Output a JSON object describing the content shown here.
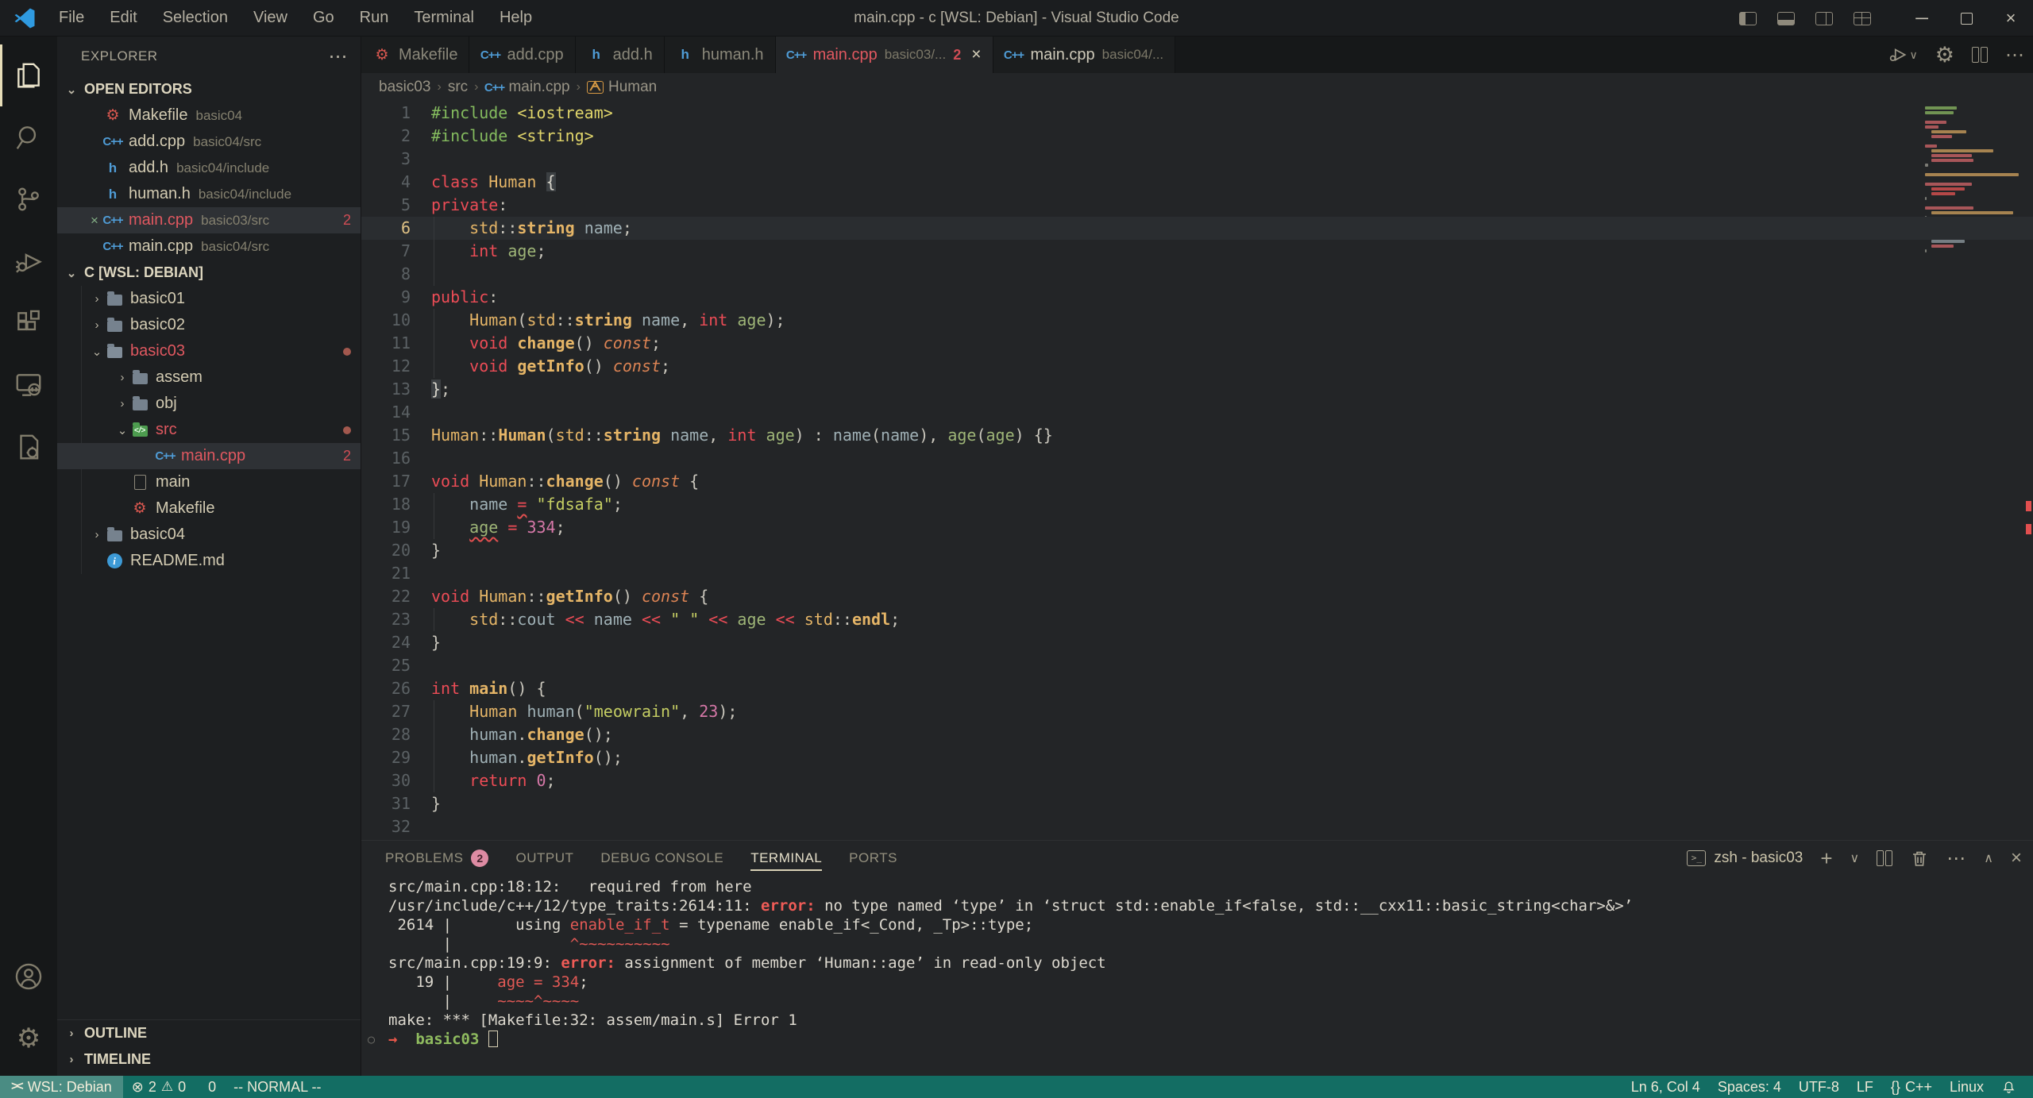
{
  "window": {
    "title": "main.cpp - c [WSL: Debian] - Visual Studio Code",
    "menu": [
      "File",
      "Edit",
      "Selection",
      "View",
      "Go",
      "Run",
      "Terminal",
      "Help"
    ]
  },
  "activity_bar": [
    "explorer",
    "search",
    "source-control",
    "run-and-debug",
    "extensions",
    "remote-explorer",
    "makefile-tools"
  ],
  "sidebar": {
    "title": "EXPLORER",
    "more_label": "⋯",
    "open_editors_label": "OPEN EDITORS",
    "open_editors": [
      {
        "icon": "makefile",
        "name": "Makefile",
        "desc": "basic04"
      },
      {
        "icon": "cpp",
        "name": "add.cpp",
        "desc": "basic04/src"
      },
      {
        "icon": "h",
        "name": "add.h",
        "desc": "basic04/include"
      },
      {
        "icon": "h",
        "name": "human.h",
        "desc": "basic04/include"
      },
      {
        "icon": "cpp",
        "name": "main.cpp",
        "desc": "basic03/src",
        "error": true,
        "badge": "2",
        "selected": true,
        "closable": true
      },
      {
        "icon": "cpp",
        "name": "main.cpp",
        "desc": "basic04/src"
      }
    ],
    "root_label": "C [WSL: DEBIAN]",
    "tree": [
      {
        "level": 1,
        "chev": "›",
        "icon": "folder",
        "name": "basic01"
      },
      {
        "level": 1,
        "chev": "›",
        "icon": "folder",
        "name": "basic02"
      },
      {
        "level": 1,
        "chev": "⌄",
        "icon": "folder-open",
        "name": "basic03",
        "error": true,
        "dot": true
      },
      {
        "level": 2,
        "chev": "›",
        "icon": "folder",
        "name": "assem"
      },
      {
        "level": 2,
        "chev": "›",
        "icon": "folder",
        "name": "obj"
      },
      {
        "level": 2,
        "chev": "⌄",
        "icon": "folder-src",
        "name": "src",
        "error": true,
        "dot": true
      },
      {
        "level": 3,
        "icon": "cpp",
        "name": "main.cpp",
        "error": true,
        "badge": "2",
        "selected": true
      },
      {
        "level": 2,
        "icon": "file",
        "name": "main"
      },
      {
        "level": 2,
        "icon": "makefile",
        "name": "Makefile"
      },
      {
        "level": 1,
        "chev": "›",
        "icon": "folder",
        "name": "basic04"
      },
      {
        "level": 1,
        "icon": "info",
        "name": "README.md"
      }
    ],
    "outline_label": "OUTLINE",
    "timeline_label": "TIMELINE"
  },
  "tabs": [
    {
      "icon": "makefile",
      "name": "Makefile"
    },
    {
      "icon": "cpp",
      "name": "add.cpp"
    },
    {
      "icon": "h",
      "name": "add.h"
    },
    {
      "icon": "h",
      "name": "human.h"
    },
    {
      "icon": "cpp",
      "name": "main.cpp",
      "desc": "basic03/...",
      "badge": "2",
      "active": true,
      "error": true,
      "closable": true
    },
    {
      "icon": "cpp",
      "name": "main.cpp",
      "desc": "basic04/...",
      "lit": true
    }
  ],
  "breadcrumb": [
    {
      "label": "basic03"
    },
    {
      "label": "src"
    },
    {
      "label": "main.cpp",
      "icon": "cpp"
    },
    {
      "label": "Human",
      "icon": "class"
    }
  ],
  "editor": {
    "lines": [
      {
        "n": 1,
        "t": [
          [
            "inc",
            "#include "
          ],
          [
            "ang",
            "<iostream>"
          ]
        ]
      },
      {
        "n": 2,
        "t": [
          [
            "inc",
            "#include "
          ],
          [
            "ang",
            "<string>"
          ]
        ]
      },
      {
        "n": 3,
        "t": []
      },
      {
        "n": 4,
        "t": [
          [
            "kw",
            "class "
          ],
          [
            "cls",
            "Human "
          ],
          [
            "brk",
            "{"
          ]
        ]
      },
      {
        "n": 5,
        "t": [
          [
            "kw",
            "private"
          ],
          [
            "pun",
            ":"
          ]
        ]
      },
      {
        "n": 6,
        "cur": true,
        "g": 1,
        "t": [
          [
            "pun",
            "    "
          ],
          [
            "std",
            "std"
          ],
          [
            "pun",
            "::"
          ],
          [
            "fn",
            "string"
          ],
          [
            "pun",
            " "
          ],
          [
            "id",
            "name"
          ],
          [
            "pun",
            ";"
          ]
        ]
      },
      {
        "n": 7,
        "g": 1,
        "t": [
          [
            "pun",
            "    "
          ],
          [
            "kw",
            "int"
          ],
          [
            "pun",
            " "
          ],
          [
            "grn",
            "age"
          ],
          [
            "pun",
            ";"
          ]
        ]
      },
      {
        "n": 8,
        "g": 1,
        "t": []
      },
      {
        "n": 9,
        "t": [
          [
            "kw",
            "public"
          ],
          [
            "pun",
            ":"
          ]
        ]
      },
      {
        "n": 10,
        "g": 1,
        "t": [
          [
            "pun",
            "    "
          ],
          [
            "cls",
            "Human"
          ],
          [
            "pun",
            "("
          ],
          [
            "std",
            "std"
          ],
          [
            "pun",
            "::"
          ],
          [
            "fn",
            "string"
          ],
          [
            "pun",
            " "
          ],
          [
            "id",
            "name"
          ],
          [
            "pun",
            ", "
          ],
          [
            "kw",
            "int"
          ],
          [
            "pun",
            " "
          ],
          [
            "grn",
            "age"
          ],
          [
            "pun",
            ");"
          ]
        ]
      },
      {
        "n": 11,
        "g": 1,
        "t": [
          [
            "pun",
            "    "
          ],
          [
            "kw",
            "void"
          ],
          [
            "pun",
            " "
          ],
          [
            "fn",
            "change"
          ],
          [
            "pun",
            "() "
          ],
          [
            "const",
            "const"
          ],
          [
            "pun",
            ";"
          ]
        ]
      },
      {
        "n": 12,
        "g": 1,
        "t": [
          [
            "pun",
            "    "
          ],
          [
            "kw",
            "void"
          ],
          [
            "pun",
            " "
          ],
          [
            "fn",
            "getInfo"
          ],
          [
            "pun",
            "() "
          ],
          [
            "const",
            "const"
          ],
          [
            "pun",
            ";"
          ]
        ]
      },
      {
        "n": 13,
        "t": [
          [
            "brk",
            "}"
          ],
          [
            "pun",
            ";"
          ]
        ]
      },
      {
        "n": 14,
        "t": []
      },
      {
        "n": 15,
        "t": [
          [
            "cls",
            "Human"
          ],
          [
            "pun",
            "::"
          ],
          [
            "fn",
            "Human"
          ],
          [
            "pun",
            "("
          ],
          [
            "std",
            "std"
          ],
          [
            "pun",
            "::"
          ],
          [
            "fn",
            "string"
          ],
          [
            "pun",
            " "
          ],
          [
            "id",
            "name"
          ],
          [
            "pun",
            ", "
          ],
          [
            "kw",
            "int"
          ],
          [
            "pun",
            " "
          ],
          [
            "grn",
            "age"
          ],
          [
            "pun",
            ") : "
          ],
          [
            "id",
            "name"
          ],
          [
            "pun",
            "("
          ],
          [
            "id",
            "name"
          ],
          [
            "pun",
            "), "
          ],
          [
            "grn",
            "age"
          ],
          [
            "pun",
            "("
          ],
          [
            "grn",
            "age"
          ],
          [
            "pun",
            ") {}"
          ]
        ]
      },
      {
        "n": 16,
        "t": []
      },
      {
        "n": 17,
        "t": [
          [
            "kw",
            "void"
          ],
          [
            "pun",
            " "
          ],
          [
            "cls",
            "Human"
          ],
          [
            "pun",
            "::"
          ],
          [
            "fn",
            "change"
          ],
          [
            "pun",
            "() "
          ],
          [
            "const",
            "const"
          ],
          [
            "pun",
            " {"
          ]
        ]
      },
      {
        "n": 18,
        "g": 1,
        "t": [
          [
            "pun",
            "    "
          ],
          [
            "id",
            "name"
          ],
          [
            "pun",
            " "
          ],
          [
            "op err",
            "="
          ],
          [
            "pun",
            " "
          ],
          [
            "str",
            "\"fdsafa\""
          ],
          [
            "pun",
            ";"
          ]
        ]
      },
      {
        "n": 19,
        "g": 1,
        "t": [
          [
            "pun",
            "    "
          ],
          [
            "grn err",
            "age"
          ],
          [
            "pun",
            " "
          ],
          [
            "op",
            "="
          ],
          [
            "pun",
            " "
          ],
          [
            "num",
            "334"
          ],
          [
            "pun",
            ";"
          ]
        ]
      },
      {
        "n": 20,
        "t": [
          [
            "pun",
            "}"
          ]
        ]
      },
      {
        "n": 21,
        "t": []
      },
      {
        "n": 22,
        "t": [
          [
            "kw",
            "void"
          ],
          [
            "pun",
            " "
          ],
          [
            "cls",
            "Human"
          ],
          [
            "pun",
            "::"
          ],
          [
            "fn",
            "getInfo"
          ],
          [
            "pun",
            "() "
          ],
          [
            "const",
            "const"
          ],
          [
            "pun",
            " {"
          ]
        ]
      },
      {
        "n": 23,
        "g": 1,
        "t": [
          [
            "pun",
            "    "
          ],
          [
            "std",
            "std"
          ],
          [
            "pun",
            "::"
          ],
          [
            "id",
            "cout"
          ],
          [
            "pun",
            " "
          ],
          [
            "op",
            "<<"
          ],
          [
            "pun",
            " "
          ],
          [
            "id",
            "name"
          ],
          [
            "pun",
            " "
          ],
          [
            "op",
            "<<"
          ],
          [
            "pun",
            " "
          ],
          [
            "str",
            "\" \""
          ],
          [
            "pun",
            " "
          ],
          [
            "op",
            "<<"
          ],
          [
            "pun",
            " "
          ],
          [
            "grn",
            "age"
          ],
          [
            "pun",
            " "
          ],
          [
            "op",
            "<<"
          ],
          [
            "pun",
            " "
          ],
          [
            "std",
            "std"
          ],
          [
            "pun",
            "::"
          ],
          [
            "fn",
            "endl"
          ],
          [
            "pun",
            ";"
          ]
        ]
      },
      {
        "n": 24,
        "t": [
          [
            "pun",
            "}"
          ]
        ]
      },
      {
        "n": 25,
        "t": []
      },
      {
        "n": 26,
        "t": [
          [
            "kw",
            "int"
          ],
          [
            "pun",
            " "
          ],
          [
            "fn",
            "main"
          ],
          [
            "pun",
            "() {"
          ]
        ]
      },
      {
        "n": 27,
        "g": 1,
        "t": [
          [
            "pun",
            "    "
          ],
          [
            "cls",
            "Human"
          ],
          [
            "pun",
            " "
          ],
          [
            "id",
            "human"
          ],
          [
            "pun",
            "("
          ],
          [
            "str",
            "\"meowrain\""
          ],
          [
            "pun",
            ", "
          ],
          [
            "num",
            "23"
          ],
          [
            "pun",
            ");"
          ]
        ]
      },
      {
        "n": 28,
        "g": 1,
        "t": [
          [
            "pun",
            "    "
          ],
          [
            "id",
            "human"
          ],
          [
            "pun",
            "."
          ],
          [
            "fn",
            "change"
          ],
          [
            "pun",
            "();"
          ]
        ]
      },
      {
        "n": 29,
        "g": 1,
        "t": [
          [
            "pun",
            "    "
          ],
          [
            "id",
            "human"
          ],
          [
            "pun",
            "."
          ],
          [
            "fn",
            "getInfo"
          ],
          [
            "pun",
            "();"
          ]
        ]
      },
      {
        "n": 30,
        "g": 1,
        "t": [
          [
            "pun",
            "    "
          ],
          [
            "kw",
            "return"
          ],
          [
            "pun",
            " "
          ],
          [
            "num",
            "0"
          ],
          [
            "pun",
            ";"
          ]
        ]
      },
      {
        "n": 31,
        "t": [
          [
            "pun",
            "}"
          ]
        ]
      },
      {
        "n": 32,
        "t": []
      }
    ]
  },
  "panel": {
    "tabs": [
      {
        "label": "PROBLEMS",
        "badge": "2"
      },
      {
        "label": "OUTPUT"
      },
      {
        "label": "DEBUG CONSOLE"
      },
      {
        "label": "TERMINAL",
        "active": true
      },
      {
        "label": "PORTS"
      }
    ],
    "shell_label": "zsh - basic03",
    "terminal_lines": [
      {
        "t": [
          [
            "w",
            "src/main.cpp:18:12:   required from here"
          ]
        ]
      },
      {
        "t": [
          [
            "w",
            "/usr/include/c++/12/type_traits:2614:11: "
          ],
          [
            "err",
            "error:"
          ],
          [
            "w",
            " no type named ‘type’ in ‘struct std::enable_if<false, std::__cxx11::basic_string<char>&>’"
          ]
        ]
      },
      {
        "t": [
          [
            "w",
            " 2614 |       using "
          ],
          [
            "red",
            "enable_if_t"
          ],
          [
            "w",
            " = typename enable_if<_Cond, _Tp>::type;"
          ]
        ]
      },
      {
        "t": [
          [
            "w",
            "      |             "
          ],
          [
            "sq",
            "^~~~~~~~~~~"
          ]
        ]
      },
      {
        "t": [
          [
            "w",
            "src/main.cpp:19:9: "
          ],
          [
            "err",
            "error:"
          ],
          [
            "w",
            " assignment of member ‘Human::age’ in read-only object"
          ]
        ]
      },
      {
        "t": [
          [
            "w",
            "   19 |     "
          ],
          [
            "red",
            "age = 334"
          ],
          [
            "w",
            ";"
          ]
        ]
      },
      {
        "t": [
          [
            "w",
            "      |     "
          ],
          [
            "sq",
            "~~~~^~~~~"
          ]
        ]
      },
      {
        "t": [
          [
            "w",
            "make: *** [Makefile:32: assem/main.s] Error 1"
          ]
        ]
      },
      {
        "prompt": true,
        "t": [
          [
            "arrow",
            "→"
          ],
          [
            "w",
            "  "
          ],
          [
            "dir",
            "basic03"
          ],
          [
            "w",
            " "
          ],
          [
            "cursor",
            ""
          ]
        ]
      }
    ]
  },
  "statusbar": {
    "remote_label": "WSL: Debian",
    "errors": "2",
    "warnings": "0",
    "ports": "0",
    "mode": "-- NORMAL --",
    "cursor_position": "Ln 6, Col 4",
    "indentation": "Spaces: 4",
    "encoding": "UTF-8",
    "eol": "LF",
    "language_braces": "{}",
    "language": "C++",
    "os": "Linux"
  }
}
